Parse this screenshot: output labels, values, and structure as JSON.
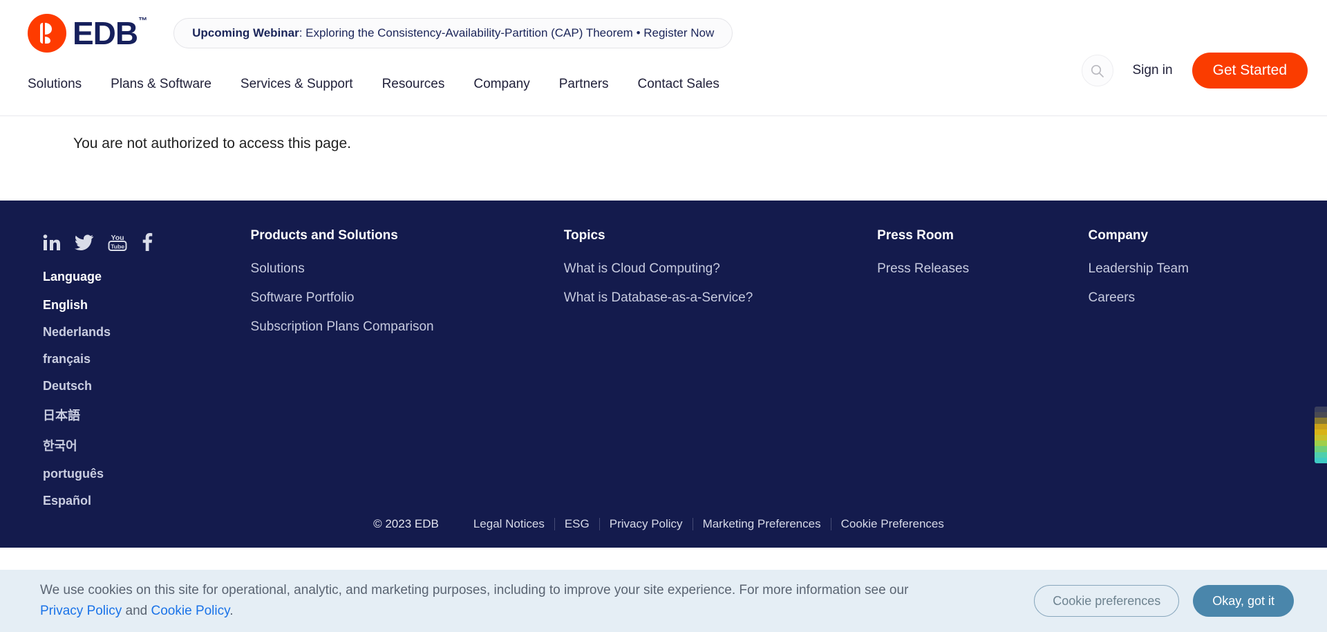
{
  "header": {
    "logo": {
      "text": "EDB",
      "tm": "™",
      "mark_color": "#fe3b00",
      "text_color": "#16205c"
    },
    "banner": {
      "lead": "Upcoming Webinar",
      "rest": ": Exploring the Consistency-Availability-Partition (CAP) Theorem • Register Now"
    },
    "nav": [
      {
        "label": "Solutions"
      },
      {
        "label": "Plans & Software"
      },
      {
        "label": "Services & Support"
      },
      {
        "label": "Resources"
      },
      {
        "label": "Company"
      },
      {
        "label": "Partners"
      },
      {
        "label": "Contact Sales"
      }
    ],
    "search_icon": "search-icon",
    "signin_label": "Sign in",
    "get_started_label": "Get Started",
    "accent_color": "#fa3c00"
  },
  "main": {
    "alert": "You are not authorized to access this page."
  },
  "footer": {
    "background": "#141b4d",
    "social": [
      {
        "name": "linkedin-icon"
      },
      {
        "name": "twitter-icon"
      },
      {
        "name": "youtube-icon"
      },
      {
        "name": "facebook-icon"
      }
    ],
    "language_title": "Language",
    "languages": [
      {
        "label": "English",
        "active": true
      },
      {
        "label": "Nederlands",
        "active": false
      },
      {
        "label": "français",
        "active": false
      },
      {
        "label": "Deutsch",
        "active": false
      },
      {
        "label": "日本語",
        "active": false
      },
      {
        "label": "한국어",
        "active": false
      },
      {
        "label": "português",
        "active": false
      },
      {
        "label": "Español",
        "active": false
      }
    ],
    "columns": [
      {
        "title": "Products and Solutions",
        "links": [
          "Solutions",
          "Software Portfolio",
          "Subscription Plans Comparison"
        ]
      },
      {
        "title": "Topics",
        "links": [
          "What is Cloud Computing?",
          "What is Database-as-a-Service?"
        ]
      },
      {
        "title": "Press Room",
        "links": [
          "Press Releases"
        ]
      },
      {
        "title": "Company",
        "links": [
          "Leadership Team",
          "Careers"
        ]
      }
    ],
    "copyright": "© 2023 EDB",
    "legal_links": [
      "Legal Notices",
      "ESG",
      "Privacy Policy",
      "Marketing Preferences",
      "Cookie Preferences"
    ]
  },
  "cookie_banner": {
    "text_part1": "We use cookies on this site for operational, analytic, and marketing purposes, including to improve your site experience. For more information see our ",
    "privacy_link": "Privacy Policy",
    "text_and": " and ",
    "cookie_link": "Cookie Policy",
    "text_end": ".",
    "preferences_label": "Cookie preferences",
    "okay_label": "Okay, got it",
    "background": "#e5eef5",
    "okay_color": "#4a86ab"
  }
}
